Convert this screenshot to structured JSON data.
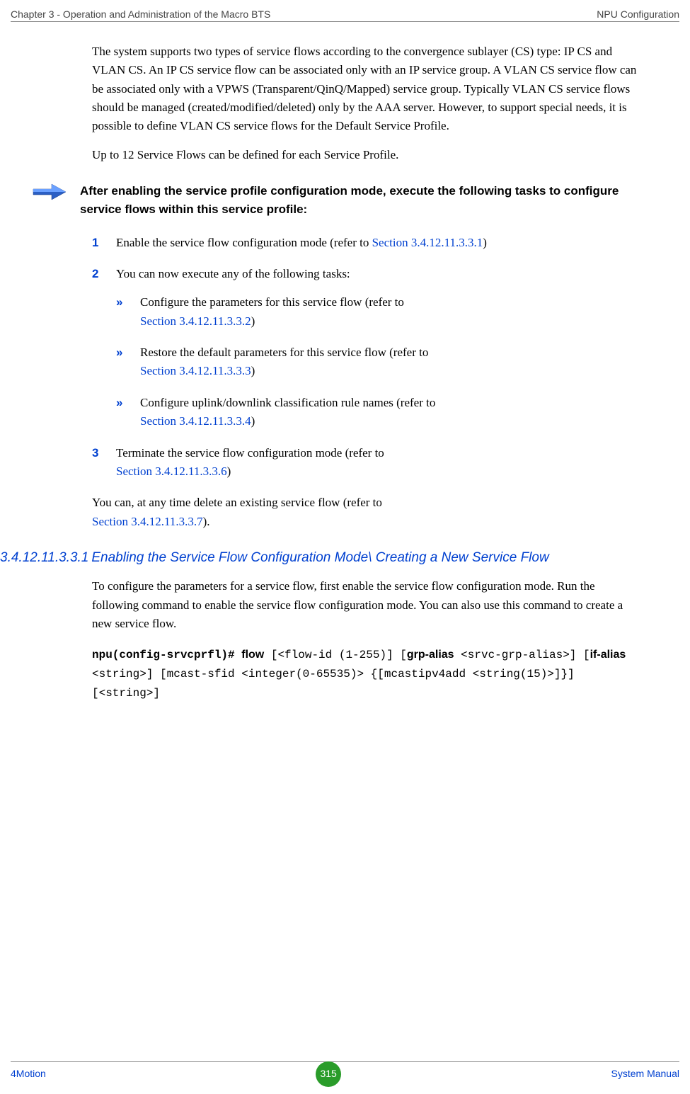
{
  "header": {
    "left": "Chapter 3 - Operation and Administration of the Macro BTS",
    "right": "NPU Configuration"
  },
  "footer": {
    "left": "4Motion",
    "page": "315",
    "right": "System Manual"
  },
  "paras": {
    "p1": "The system supports two types of service flows according to the convergence sublayer (CS) type: IP CS and VLAN CS. An IP CS service flow can be associated only with an IP service group. A VLAN CS service flow can be associated only with a VPWS (Transparent/QinQ/Mapped) service group. Typically VLAN CS service flows should be managed (created/modified/deleted) only by the AAA server. However, to support special needs, it is possible to define VLAN CS service flows for the Default Service Profile.",
    "p2": "Up to 12 Service Flows can be defined for each Service Profile."
  },
  "note": "After enabling the service profile configuration mode, execute the following tasks to configure service flows within this service profile:",
  "steps": {
    "s1a": "Enable the service flow configuration mode (refer to ",
    "s1link": "Section 3.4.12.11.3.3.1",
    "s1b": ")",
    "s2": "You can now execute any of the following tasks:",
    "s2aA": "Configure the parameters for this service flow (refer to ",
    "s2aLink": "Section 3.4.12.11.3.3.2",
    "s2aB": ")",
    "s2bA": "Restore the default parameters for this service flow (refer to ",
    "s2bLink": "Section 3.4.12.11.3.3.3",
    "s2bB": ")",
    "s2cA": "Configure uplink/downlink classification rule names (refer to ",
    "s2cLink": "Section 3.4.12.11.3.3.4",
    "s2cB": ")",
    "s3a": "Terminate the service flow configuration mode (refer to ",
    "s3link": "Section 3.4.12.11.3.3.6",
    "s3b": ")"
  },
  "afterSteps": {
    "a": "You can, at any time delete an existing service flow (refer to ",
    "link": "Section 3.4.12.11.3.3.7",
    "b": ")."
  },
  "subhead": {
    "num": "3.4.12.11.3.3.1",
    "title": "Enabling the Service Flow Configuration Mode\\ Creating a New Service Flow"
  },
  "subpara": "To configure the parameters for a service flow, first enable the service flow configuration mode. Run the following command to enable the service flow configuration mode. You can also use this command to create a new service flow.",
  "cmd": {
    "prompt": "npu(config-srvcprfl)# ",
    "flow": "flow",
    "p1": " [<flow-id (1-255)] [",
    "grp": "grp-alias",
    "p2": " <srvc-grp-alias>] [",
    "if": "if-alias",
    "p3": " <string>] [mcast-sfid <integer(0-65535)> {[mcastipv4add <string(15)>]}] [<string>]"
  }
}
